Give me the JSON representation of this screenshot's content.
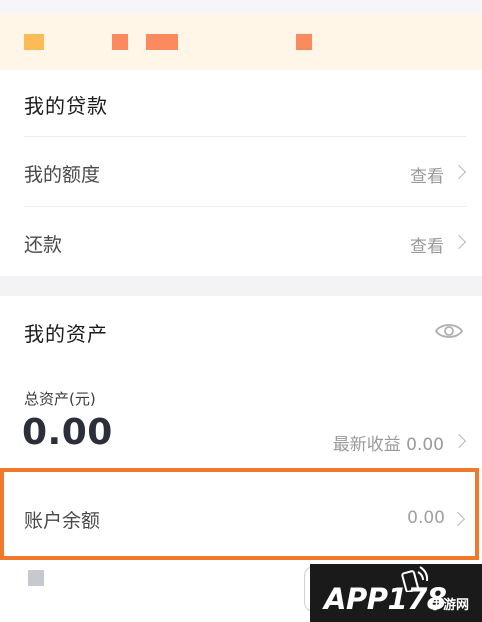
{
  "loan_section": {
    "title": "我的贷款",
    "items": [
      {
        "label": "我的额度",
        "action": "查看"
      },
      {
        "label": "还款",
        "action": "查看"
      }
    ]
  },
  "asset_section": {
    "title": "我的资产",
    "visibility_icon": "eye-icon",
    "total_label": "总资产(元)",
    "total_value": "0.00",
    "earnings_label": "最新收益",
    "earnings_value": "0.00",
    "balance_label": "账户余额",
    "balance_value": "0.00"
  },
  "colors": {
    "banner_bg": "#fff6e8",
    "highlight_border": "#f07a2a",
    "value_dark": "#2a2f3a"
  },
  "watermark": {
    "text": "APP178",
    "sub": "手游网"
  }
}
